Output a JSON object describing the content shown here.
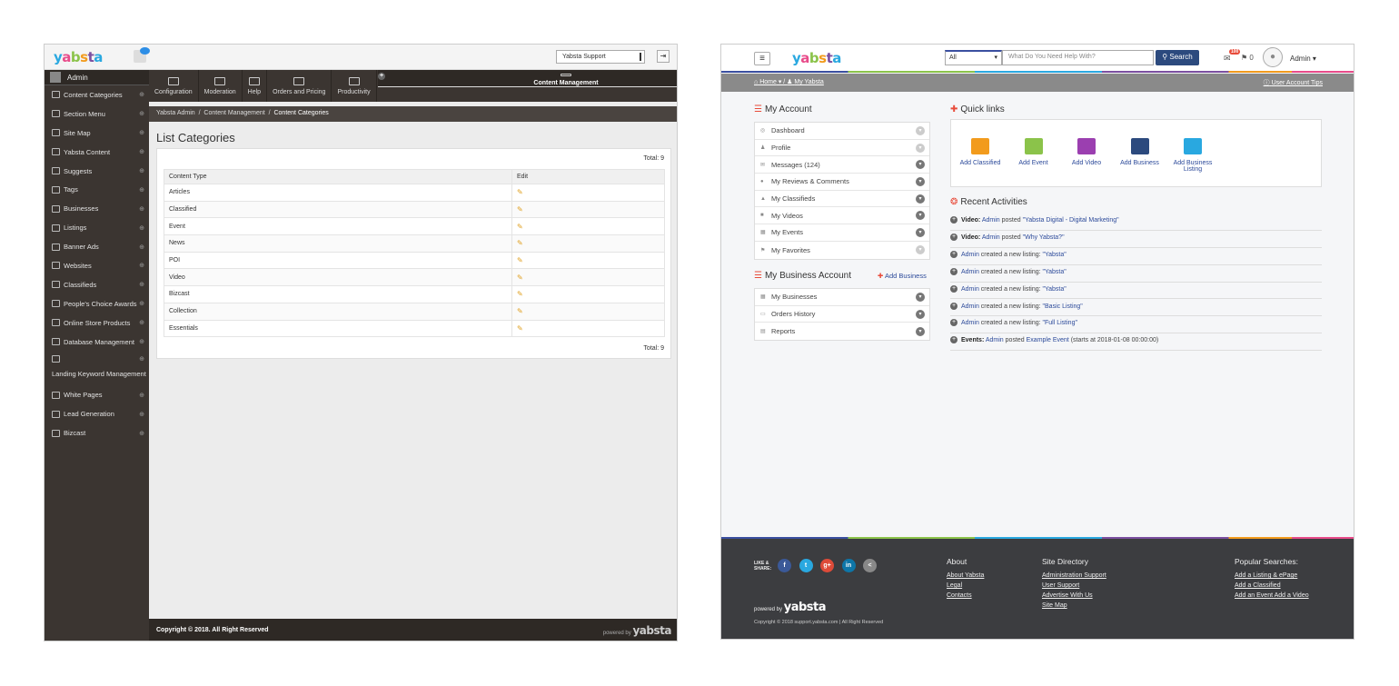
{
  "left": {
    "logo": [
      "y",
      "a",
      "b",
      "s",
      "t",
      "a"
    ],
    "support_select": "Yabsta Support",
    "sidebar": {
      "admin_label": "Admin",
      "items": [
        {
          "label": "Content Categories"
        },
        {
          "label": "Section Menu"
        },
        {
          "label": "Site Map"
        },
        {
          "label": "Yabsta Content"
        },
        {
          "label": "Suggests"
        },
        {
          "label": "Tags"
        },
        {
          "label": "Businesses"
        },
        {
          "label": "Listings"
        },
        {
          "label": "Banner Ads"
        },
        {
          "label": "Websites"
        },
        {
          "label": "Classifieds"
        },
        {
          "label": "People's Choice Awards"
        },
        {
          "label": "Online Store Products"
        },
        {
          "label": "Database Management"
        },
        {
          "label": "Landing Keyword Management"
        },
        {
          "label": "White Pages"
        },
        {
          "label": "Lead Generation"
        },
        {
          "label": "Bizcast"
        }
      ]
    },
    "topnav": [
      {
        "label": "Configuration"
      },
      {
        "label": "Content Management"
      },
      {
        "label": "Moderation"
      },
      {
        "label": "Help"
      },
      {
        "label": "Orders and Pricing"
      },
      {
        "label": "Productivity"
      }
    ],
    "breadcrumb": {
      "a": "Yabsta Admin",
      "b": "Content Management",
      "c": "Content Categories"
    },
    "page_title": "List Categories",
    "total_top": "Total: 9",
    "total_bottom": "Total: 9",
    "table": {
      "col1": "Content Type",
      "col2": "Edit",
      "rows": [
        "Articles",
        "Classified",
        "Event",
        "News",
        "POI",
        "Video",
        "Bizcast",
        "Collection",
        "Essentials"
      ]
    },
    "footer": {
      "copyright": "Copyright © 2018. All Right Reserved",
      "powered": "powered by"
    }
  },
  "right": {
    "search": {
      "category": "All",
      "placeholder": "What Do You Need Help With?",
      "button": "Search"
    },
    "mail_count": "100",
    "flag_count": "0",
    "user": "Admin",
    "breadcrumb": {
      "home": "Home",
      "current": "My Yabsta",
      "tips": "User Account Tips"
    },
    "my_account": {
      "title": "My Account",
      "items": [
        {
          "label": "Dashboard"
        },
        {
          "label": "Profile"
        },
        {
          "label": "Messages (124)"
        },
        {
          "label": "My Reviews & Comments"
        },
        {
          "label": "My Classifieds"
        },
        {
          "label": "My Videos"
        },
        {
          "label": "My Events"
        },
        {
          "label": "My Favorites"
        }
      ]
    },
    "my_business": {
      "title": "My Business Account",
      "add": "Add Business",
      "items": [
        {
          "label": "My Businesses"
        },
        {
          "label": "Orders History"
        },
        {
          "label": "Reports"
        }
      ]
    },
    "quick_links": {
      "title": "Quick links",
      "items": [
        {
          "label": "Add Classified",
          "color": "#f29b1d"
        },
        {
          "label": "Add Event",
          "color": "#8bc34a"
        },
        {
          "label": "Add Video",
          "color": "#9b3fb0"
        },
        {
          "label": "Add Business",
          "color": "#2c4a7e"
        },
        {
          "label": "Add Business Listing",
          "color": "#29a8e0"
        }
      ]
    },
    "recent": {
      "title": "Recent Activities",
      "items": [
        {
          "prefix": "Video:",
          "user": "Admin",
          "action": "posted",
          "target": "\"Yabsta Digital - Digital Marketing\"",
          "extra": ""
        },
        {
          "prefix": "Video:",
          "user": "Admin",
          "action": "posted",
          "target": "\"Why Yabsta?\"",
          "extra": ""
        },
        {
          "prefix": "",
          "user": "Admin",
          "action": "created a new listing:",
          "target": "\"Yabsta\"",
          "extra": ""
        },
        {
          "prefix": "",
          "user": "Admin",
          "action": "created a new listing:",
          "target": "\"Yabsta\"",
          "extra": ""
        },
        {
          "prefix": "",
          "user": "Admin",
          "action": "created a new listing:",
          "target": "\"Yabsta\"",
          "extra": ""
        },
        {
          "prefix": "",
          "user": "Admin",
          "action": "created a new listing:",
          "target": "\"Basic Listing\"",
          "extra": ""
        },
        {
          "prefix": "",
          "user": "Admin",
          "action": "created a new listing:",
          "target": "\"Full Listing\"",
          "extra": ""
        },
        {
          "prefix": "Events:",
          "user": "Admin",
          "action": "posted",
          "target": "Example Event",
          "extra": "(starts at 2018-01-08 00:00:00)"
        }
      ]
    },
    "footer": {
      "share": "LIKE & SHARE:",
      "social": [
        {
          "label": "f",
          "color": "#3b5998"
        },
        {
          "label": "t",
          "color": "#29a8e0"
        },
        {
          "label": "g+",
          "color": "#dd4b39"
        },
        {
          "label": "in",
          "color": "#0e76a8"
        },
        {
          "label": "<",
          "color": "#888"
        }
      ],
      "powered": "powered by",
      "copyright": "Copyright © 2018 support.yabsta.com | All Right Reserved",
      "about": {
        "title": "About",
        "links": [
          "About Yabsta",
          "Legal",
          "Contacts"
        ]
      },
      "directory": {
        "title": "Site Directory",
        "links": [
          "Administration Support",
          "User Support",
          "Advertise With Us",
          "Site Map"
        ]
      },
      "popular": {
        "title": "Popular Searches:",
        "links": [
          "Add a Listing & ePage",
          "Add a Classified",
          "Add an Event Add a Video"
        ]
      }
    }
  }
}
